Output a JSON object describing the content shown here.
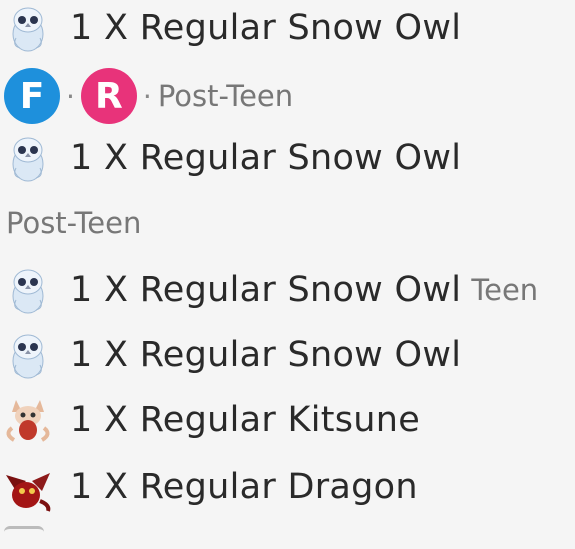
{
  "rows": [
    {
      "text": "1 X Regular Snow Owl",
      "icon": "snow-owl-icon"
    },
    {
      "text": "1 X Regular Snow Owl",
      "icon": "snow-owl-icon"
    },
    {
      "text": "1 X Regular Snow Owl",
      "icon": "snow-owl-icon",
      "tag": "Teen"
    },
    {
      "text": "1 X Regular Snow Owl",
      "icon": "snow-owl-icon"
    },
    {
      "text": "1 X Regular Kitsune",
      "icon": "kitsune-icon"
    },
    {
      "text": "1 X Regular Dragon",
      "icon": "dragon-icon"
    }
  ],
  "badges": {
    "fly": {
      "letter": "F",
      "color": "#1e90dc",
      "icon": "fly-badge-icon"
    },
    "ride": {
      "letter": "R",
      "color": "#e8337a",
      "icon": "ride-badge-icon"
    },
    "separator": "·",
    "age": "Post-Teen"
  },
  "section_label": "Post-Teen",
  "colors": {
    "background": "#f5f5f5",
    "text": "#2a2a2a",
    "muted": "#777777"
  }
}
